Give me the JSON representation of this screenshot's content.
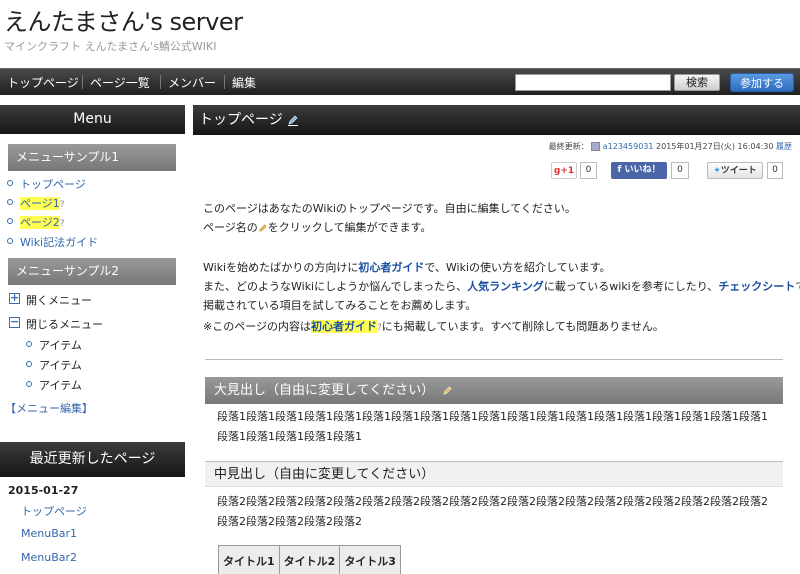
{
  "header": {
    "site_title": "えんたまさん's server",
    "site_description": "マインクラフト えんたまさん's鯖公式WIKI"
  },
  "nav": {
    "items": [
      "トップページ",
      "ページ一覧",
      "メンバー",
      "編集"
    ],
    "search_button": "検索",
    "join_button": "参加する",
    "search_value": ""
  },
  "sidebar": {
    "title": "Menu",
    "section1": "メニューサンプル1",
    "links1": [
      "トップページ",
      "ページ1",
      "ページ2",
      "Wiki記法ガイド"
    ],
    "qmark": "?",
    "section2": "メニューサンプル2",
    "open_menu": "開くメニュー",
    "close_menu": "閉じるメニュー",
    "items": [
      "アイテム",
      "アイテム",
      "アイテム"
    ],
    "edit_menu": "【メニュー編集】",
    "recent_title": "最近更新したページ",
    "recent_date": "2015-01-27",
    "recent_links": [
      "トップページ",
      "MenuBar1",
      "MenuBar2"
    ]
  },
  "main": {
    "page_title": "トップページ",
    "last_updated_label": "最終更新：",
    "last_updated_user": "a123459031",
    "last_updated_time": "2015年01月27日(火) 16:04:30",
    "history_link": "履歴",
    "social": {
      "gplus": "g+1",
      "gplus_count": "0",
      "fb_like": "いいね！",
      "fb_count": "0",
      "tweet": "ツイート",
      "tweet_count": "0"
    },
    "intro1": "このページはあなたのWikiのトップページです。自由に編集してください。",
    "intro2a": "ページ名の",
    "intro2b": "をクリックして編集ができます。",
    "line3a": "Wikiを始めたばかりの方向けに",
    "line3link": "初心者ガイド",
    "line3b": "で、Wikiの使い方を紹介しています。",
    "line4a": "また、どのようなWikiにしようか悩んでしまったら、",
    "line4link1": "人気ランキング",
    "line4b": "に載っているwikiを参考にしたり、",
    "line4link2": "チェックシート",
    "line4c": "で",
    "line5": "掲載されている項目を試してみることをお薦めします。",
    "line6a": "※このページの内容は",
    "line6link": "初心者ガイド",
    "line6b": "にも掲載しています。すべて削除しても問題ありません。",
    "h_large": "大見出し（自由に変更してください）",
    "para1": "段落1段落1段落1段落1段落1段落1段落1段落1段落1段落1段落1段落1段落1段落1段落1段落1段落1段落1段落1段落1段落1段落1段落1段落1",
    "h_medium": "中見出し（自由に変更してください）",
    "para2": "段落2段落2段落2段落2段落2段落2段落2段落2段落2段落2段落2段落2段落2段落2段落2段落2段落2段落2段落2段落2段落2段落2段落2段落2",
    "table_headers": [
      "タイトル1",
      "タイトル2",
      "タイトル3"
    ]
  }
}
